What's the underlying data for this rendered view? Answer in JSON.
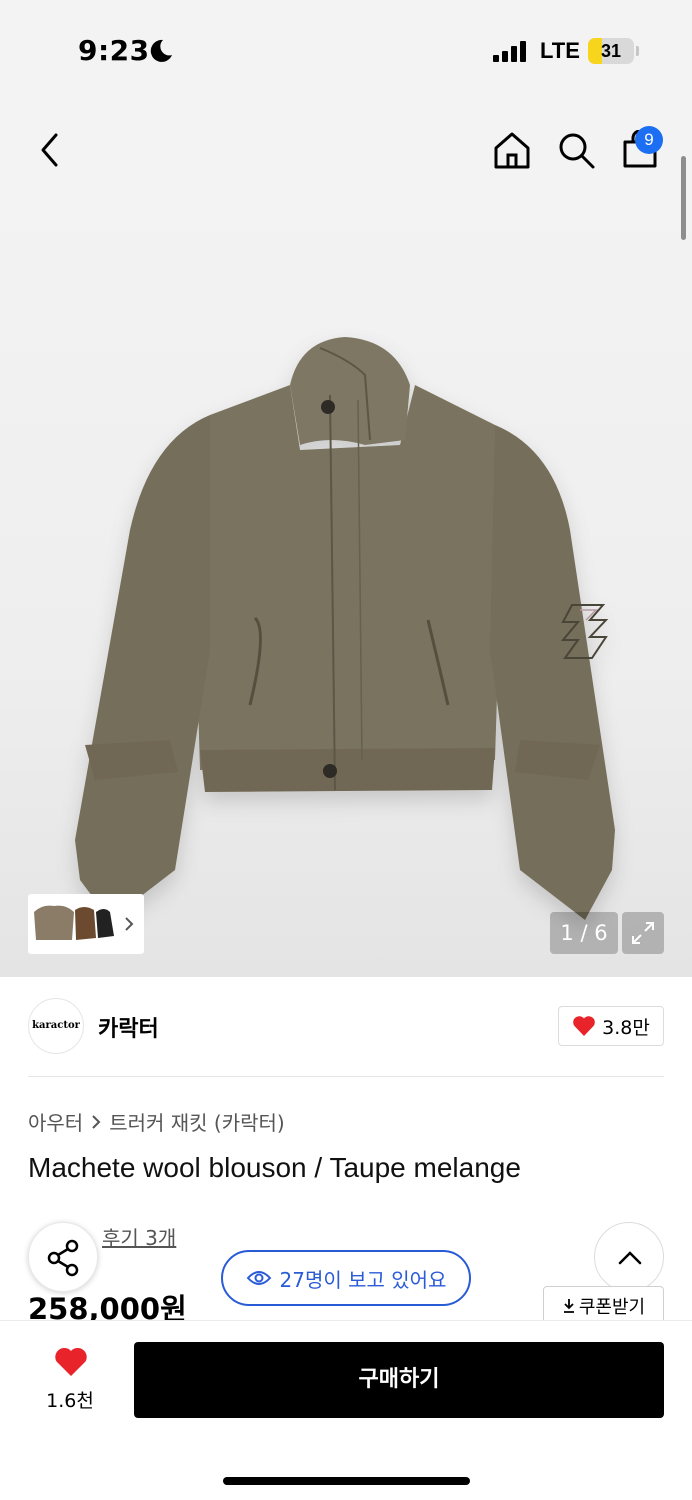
{
  "status": {
    "time": "9:23",
    "network": "LTE",
    "battery_level": "31",
    "battery_fraction": 0.31
  },
  "header": {
    "cart_count": "9"
  },
  "gallery": {
    "counter": "1 / 6"
  },
  "brand": {
    "logo_text": "karactor",
    "name": "카락터",
    "likes": "3.8만"
  },
  "product": {
    "breadcrumb": [
      "아우터",
      "트러커 재킷 (카락터)"
    ],
    "title": "Machete wool blouson / Taupe melange",
    "review_link": "후기 3개",
    "price": "258,000원"
  },
  "floating": {
    "viewers": "27명이 보고 있어요",
    "coupon": "쿠폰받기"
  },
  "bottom": {
    "wish_count": "1.6천",
    "buy_label": "구매하기"
  },
  "colors": {
    "accent_blue": "#2a5bd7",
    "badge_blue": "#1c6ef2",
    "heart_red": "#e8232a",
    "jacket": "#7a735f"
  }
}
